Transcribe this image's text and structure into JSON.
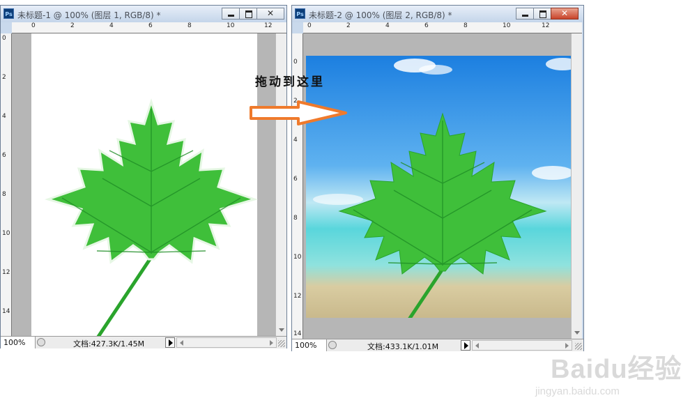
{
  "windows": [
    {
      "icon_label": "Ps",
      "title": "未标题-1 @ 100% (图层 1, RGB/8) *",
      "zoom": "100%",
      "doc_info": "文档:427.3K/1.45M",
      "ruler_top_labels": [
        "0",
        "2",
        "4",
        "6",
        "8",
        "10",
        "12"
      ],
      "ruler_left_labels": [
        "0",
        "2",
        "4",
        "6",
        "8",
        "10",
        "12",
        "14"
      ],
      "close_hover": false
    },
    {
      "icon_label": "Ps",
      "title": "未标题-2 @ 100% (图层 2, RGB/8) *",
      "zoom": "100%",
      "doc_info": "文档:433.1K/1.01M",
      "ruler_top_labels": [
        "0",
        "2",
        "4",
        "6",
        "8",
        "10",
        "12"
      ],
      "ruler_left_labels": [
        "0",
        "2",
        "4",
        "6",
        "8",
        "10",
        "12",
        "14"
      ],
      "close_hover": true
    }
  ],
  "annotation": {
    "text": "拖动到这里",
    "arrow_color": "#ef7a2c"
  },
  "watermark": {
    "main": "Baidu经验",
    "sub": "jingyan.baidu.com"
  },
  "colors": {
    "leaf": "#3fbf3a",
    "leaf_dark": "#1f8e26",
    "sky": "#2f8fe6",
    "sea": "#59d6dc",
    "sand": "#d9cca1",
    "canvas_bg": "#b6b6b6"
  }
}
